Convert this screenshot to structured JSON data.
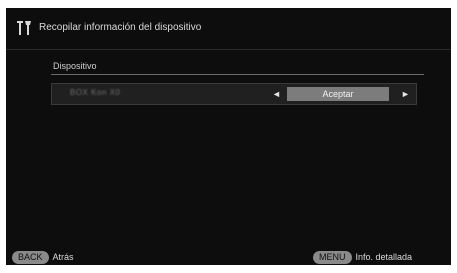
{
  "header": {
    "title": "Recopilar información del dispositivo",
    "icon": "tools-icon"
  },
  "section": {
    "label": "Dispositivo"
  },
  "device_row": {
    "name": "BOX Kon X0",
    "left_arrow": "◄",
    "right_arrow": "►",
    "accept_label": "Aceptar"
  },
  "footer": {
    "back_key": "BACK",
    "back_label": "Atrás",
    "menu_key": "MENU",
    "menu_label": "Info. detallada"
  },
  "colors": {
    "background": "#0d0d0d",
    "accent_button": "#7c7c7c",
    "key_pill": "#8a8a8a"
  }
}
